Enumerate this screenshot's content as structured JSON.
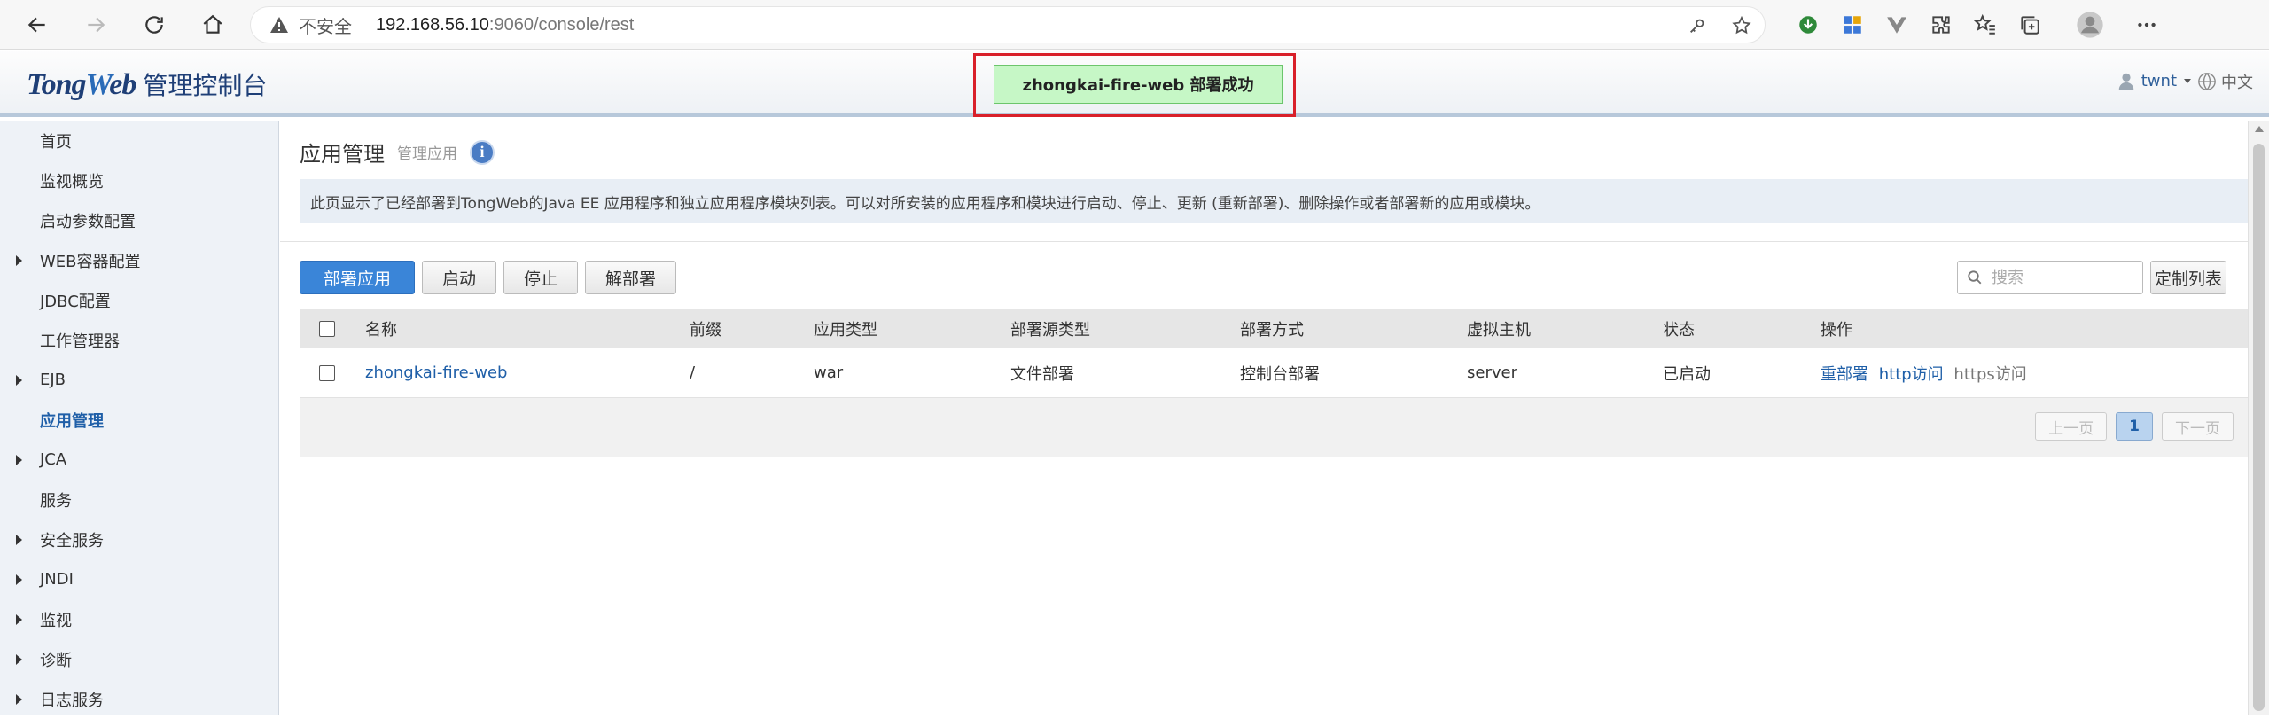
{
  "browser": {
    "insecure_label": "不安全",
    "url_host": "192.168.56.10",
    "url_path": ":9060/console/rest"
  },
  "header": {
    "brand_tong": "Tong",
    "brand_w": "W",
    "brand_eb": "eb",
    "console_label": "管理控制台",
    "notice": "zhongkai-fire-web 部署成功",
    "user": "twnt",
    "lang": "中文"
  },
  "sidebar": {
    "items": [
      {
        "label": "首页",
        "expandable": false
      },
      {
        "label": "监视概览",
        "expandable": false
      },
      {
        "label": "启动参数配置",
        "expandable": false
      },
      {
        "label": "WEB容器配置",
        "expandable": true
      },
      {
        "label": "JDBC配置",
        "expandable": false
      },
      {
        "label": "工作管理器",
        "expandable": false
      },
      {
        "label": "EJB",
        "expandable": true
      },
      {
        "label": "应用管理",
        "expandable": false,
        "active": true
      },
      {
        "label": "JCA",
        "expandable": true
      },
      {
        "label": "服务",
        "expandable": false
      },
      {
        "label": "安全服务",
        "expandable": true
      },
      {
        "label": "JNDI",
        "expandable": true
      },
      {
        "label": "监视",
        "expandable": true
      },
      {
        "label": "诊断",
        "expandable": true
      },
      {
        "label": "日志服务",
        "expandable": true
      }
    ]
  },
  "main": {
    "title": "应用管理",
    "subtitle": "管理应用",
    "info_icon": "i",
    "description": "此页显示了已经部署到TongWeb的Java EE 应用程序和独立应用程序模块列表。可以对所安装的应用程序和模块进行启动、停止、更新 (重新部署)、删除操作或者部署新的应用或模块。",
    "toolbar": {
      "deploy": "部署应用",
      "start": "启动",
      "stop": "停止",
      "undeploy": "解部署"
    },
    "search_placeholder": "搜索",
    "customize_label": "定制列表",
    "columns": [
      "名称",
      "前缀",
      "应用类型",
      "部署源类型",
      "部署方式",
      "虚拟主机",
      "状态",
      "操作"
    ],
    "rows": [
      {
        "name": "zhongkai-fire-web",
        "prefix": "/",
        "app_type": "war",
        "source_type": "文件部署",
        "deploy_mode": "控制台部署",
        "vhost": "server",
        "status": "已启动",
        "ops": [
          "重部署",
          "http访问",
          "https访问"
        ]
      }
    ],
    "pager": {
      "prev": "上一页",
      "current": "1",
      "next": "下一页"
    }
  },
  "colors": {
    "primary": "#3a85d8",
    "link": "#1f5fa8",
    "notice_bg": "#c6f7c6",
    "highlight_border": "#d9202a"
  }
}
